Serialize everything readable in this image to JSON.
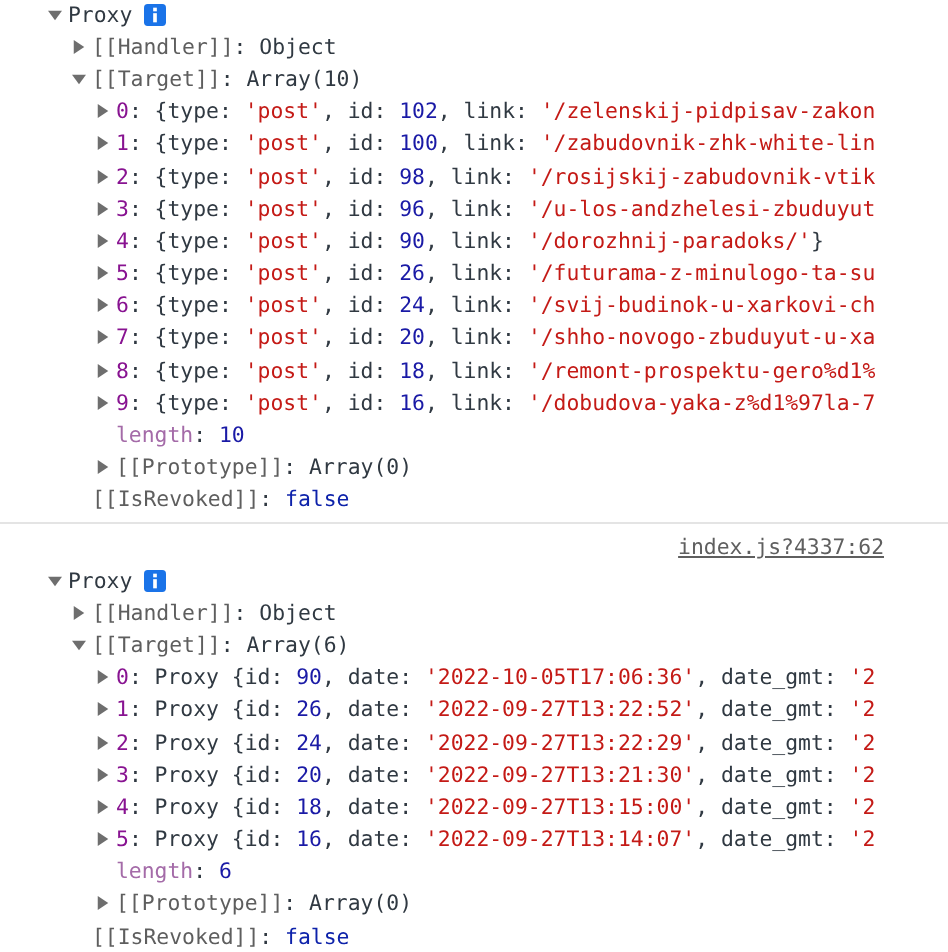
{
  "logs": [
    {
      "tree": {
        "kind": "toggle",
        "expanded": true,
        "info": true,
        "parts": [
          {
            "kind": "plain",
            "text": "Proxy"
          }
        ],
        "children": [
          {
            "kind": "toggle",
            "expanded": false,
            "parts": [
              {
                "kind": "meta",
                "text": "[[Handler]]"
              },
              {
                "kind": "plain",
                "text": ": Object"
              }
            ]
          },
          {
            "kind": "toggle",
            "expanded": true,
            "parts": [
              {
                "kind": "meta",
                "text": "[[Target]]"
              },
              {
                "kind": "plain",
                "text": ": Array(10)"
              }
            ],
            "children": [
              {
                "kind": "toggle",
                "expanded": false,
                "parts": [
                  {
                    "kind": "index",
                    "text": "0"
                  },
                  {
                    "kind": "plain",
                    "text": ": {type: "
                  },
                  {
                    "kind": "str",
                    "text": "'post'"
                  },
                  {
                    "kind": "plain",
                    "text": ", id: "
                  },
                  {
                    "kind": "num",
                    "text": "102"
                  },
                  {
                    "kind": "plain",
                    "text": ", link: "
                  },
                  {
                    "kind": "str",
                    "text": "'/zelenskij-pidpisav-zakon"
                  }
                ]
              },
              {
                "kind": "toggle",
                "expanded": false,
                "parts": [
                  {
                    "kind": "index",
                    "text": "1"
                  },
                  {
                    "kind": "plain",
                    "text": ": {type: "
                  },
                  {
                    "kind": "str",
                    "text": "'post'"
                  },
                  {
                    "kind": "plain",
                    "text": ", id: "
                  },
                  {
                    "kind": "num",
                    "text": "100"
                  },
                  {
                    "kind": "plain",
                    "text": ", link: "
                  },
                  {
                    "kind": "str",
                    "text": "'/zabudovnik-zhk-white-lin"
                  }
                ]
              },
              {
                "kind": "toggle",
                "expanded": false,
                "parts": [
                  {
                    "kind": "index",
                    "text": "2"
                  },
                  {
                    "kind": "plain",
                    "text": ": {type: "
                  },
                  {
                    "kind": "str",
                    "text": "'post'"
                  },
                  {
                    "kind": "plain",
                    "text": ", id: "
                  },
                  {
                    "kind": "num",
                    "text": "98"
                  },
                  {
                    "kind": "plain",
                    "text": ", link: "
                  },
                  {
                    "kind": "str",
                    "text": "'/rosijskij-zabudovnik-vtik"
                  }
                ]
              },
              {
                "kind": "toggle",
                "expanded": false,
                "parts": [
                  {
                    "kind": "index",
                    "text": "3"
                  },
                  {
                    "kind": "plain",
                    "text": ": {type: "
                  },
                  {
                    "kind": "str",
                    "text": "'post'"
                  },
                  {
                    "kind": "plain",
                    "text": ", id: "
                  },
                  {
                    "kind": "num",
                    "text": "96"
                  },
                  {
                    "kind": "plain",
                    "text": ", link: "
                  },
                  {
                    "kind": "str",
                    "text": "'/u-los-andzhelesi-zbuduyut"
                  }
                ]
              },
              {
                "kind": "toggle",
                "expanded": false,
                "parts": [
                  {
                    "kind": "index",
                    "text": "4"
                  },
                  {
                    "kind": "plain",
                    "text": ": {type: "
                  },
                  {
                    "kind": "str",
                    "text": "'post'"
                  },
                  {
                    "kind": "plain",
                    "text": ", id: "
                  },
                  {
                    "kind": "num",
                    "text": "90"
                  },
                  {
                    "kind": "plain",
                    "text": ", link: "
                  },
                  {
                    "kind": "str",
                    "text": "'/dorozhnij-paradoks/'"
                  },
                  {
                    "kind": "plain",
                    "text": "}"
                  }
                ]
              },
              {
                "kind": "toggle",
                "expanded": false,
                "parts": [
                  {
                    "kind": "index",
                    "text": "5"
                  },
                  {
                    "kind": "plain",
                    "text": ": {type: "
                  },
                  {
                    "kind": "str",
                    "text": "'post'"
                  },
                  {
                    "kind": "plain",
                    "text": ", id: "
                  },
                  {
                    "kind": "num",
                    "text": "26"
                  },
                  {
                    "kind": "plain",
                    "text": ", link: "
                  },
                  {
                    "kind": "str",
                    "text": "'/futurama-z-minulogo-ta-su"
                  }
                ]
              },
              {
                "kind": "toggle",
                "expanded": false,
                "parts": [
                  {
                    "kind": "index",
                    "text": "6"
                  },
                  {
                    "kind": "plain",
                    "text": ": {type: "
                  },
                  {
                    "kind": "str",
                    "text": "'post'"
                  },
                  {
                    "kind": "plain",
                    "text": ", id: "
                  },
                  {
                    "kind": "num",
                    "text": "24"
                  },
                  {
                    "kind": "plain",
                    "text": ", link: "
                  },
                  {
                    "kind": "str",
                    "text": "'/svij-budinok-u-xarkovi-ch"
                  }
                ]
              },
              {
                "kind": "toggle",
                "expanded": false,
                "parts": [
                  {
                    "kind": "index",
                    "text": "7"
                  },
                  {
                    "kind": "plain",
                    "text": ": {type: "
                  },
                  {
                    "kind": "str",
                    "text": "'post'"
                  },
                  {
                    "kind": "plain",
                    "text": ", id: "
                  },
                  {
                    "kind": "num",
                    "text": "20"
                  },
                  {
                    "kind": "plain",
                    "text": ", link: "
                  },
                  {
                    "kind": "str",
                    "text": "'/shho-novogo-zbuduyut-u-xa"
                  }
                ]
              },
              {
                "kind": "toggle",
                "expanded": false,
                "parts": [
                  {
                    "kind": "index",
                    "text": "8"
                  },
                  {
                    "kind": "plain",
                    "text": ": {type: "
                  },
                  {
                    "kind": "str",
                    "text": "'post'"
                  },
                  {
                    "kind": "plain",
                    "text": ", id: "
                  },
                  {
                    "kind": "num",
                    "text": "18"
                  },
                  {
                    "kind": "plain",
                    "text": ", link: "
                  },
                  {
                    "kind": "str",
                    "text": "'/remont-prospektu-gero%d1%"
                  }
                ]
              },
              {
                "kind": "toggle",
                "expanded": false,
                "parts": [
                  {
                    "kind": "index",
                    "text": "9"
                  },
                  {
                    "kind": "plain",
                    "text": ": {type: "
                  },
                  {
                    "kind": "str",
                    "text": "'post'"
                  },
                  {
                    "kind": "plain",
                    "text": ", id: "
                  },
                  {
                    "kind": "num",
                    "text": "16"
                  },
                  {
                    "kind": "plain",
                    "text": ", link: "
                  },
                  {
                    "kind": "str",
                    "text": "'/dobudova-yaka-z%d1%97la-7"
                  }
                ]
              },
              {
                "kind": "leaf",
                "parts": [
                  {
                    "kind": "lenkey",
                    "text": "length"
                  },
                  {
                    "kind": "plain",
                    "text": ": "
                  },
                  {
                    "kind": "num",
                    "text": "10"
                  }
                ]
              },
              {
                "kind": "toggle",
                "expanded": false,
                "parts": [
                  {
                    "kind": "meta",
                    "text": "[[Prototype]]"
                  },
                  {
                    "kind": "plain",
                    "text": ": Array(0)"
                  }
                ]
              }
            ]
          },
          {
            "kind": "leaf",
            "parts": [
              {
                "kind": "meta",
                "text": "[[IsRevoked]]"
              },
              {
                "kind": "plain",
                "text": ": "
              },
              {
                "kind": "bool",
                "text": "false"
              }
            ]
          }
        ]
      }
    },
    {
      "source": "index.js?4337:62",
      "tree": {
        "kind": "toggle",
        "expanded": true,
        "info": true,
        "parts": [
          {
            "kind": "plain",
            "text": "Proxy"
          }
        ],
        "children": [
          {
            "kind": "toggle",
            "expanded": false,
            "parts": [
              {
                "kind": "meta",
                "text": "[[Handler]]"
              },
              {
                "kind": "plain",
                "text": ": Object"
              }
            ]
          },
          {
            "kind": "toggle",
            "expanded": true,
            "parts": [
              {
                "kind": "meta",
                "text": "[[Target]]"
              },
              {
                "kind": "plain",
                "text": ": Array(6)"
              }
            ],
            "children": [
              {
                "kind": "toggle",
                "expanded": false,
                "parts": [
                  {
                    "kind": "index",
                    "text": "0"
                  },
                  {
                    "kind": "plain",
                    "text": ": Proxy {id: "
                  },
                  {
                    "kind": "num",
                    "text": "90"
                  },
                  {
                    "kind": "plain",
                    "text": ", date: "
                  },
                  {
                    "kind": "str",
                    "text": "'2022-10-05T17:06:36'"
                  },
                  {
                    "kind": "plain",
                    "text": ", date_gmt: "
                  },
                  {
                    "kind": "str",
                    "text": "'2"
                  }
                ]
              },
              {
                "kind": "toggle",
                "expanded": false,
                "parts": [
                  {
                    "kind": "index",
                    "text": "1"
                  },
                  {
                    "kind": "plain",
                    "text": ": Proxy {id: "
                  },
                  {
                    "kind": "num",
                    "text": "26"
                  },
                  {
                    "kind": "plain",
                    "text": ", date: "
                  },
                  {
                    "kind": "str",
                    "text": "'2022-09-27T13:22:52'"
                  },
                  {
                    "kind": "plain",
                    "text": ", date_gmt: "
                  },
                  {
                    "kind": "str",
                    "text": "'2"
                  }
                ]
              },
              {
                "kind": "toggle",
                "expanded": false,
                "parts": [
                  {
                    "kind": "index",
                    "text": "2"
                  },
                  {
                    "kind": "plain",
                    "text": ": Proxy {id: "
                  },
                  {
                    "kind": "num",
                    "text": "24"
                  },
                  {
                    "kind": "plain",
                    "text": ", date: "
                  },
                  {
                    "kind": "str",
                    "text": "'2022-09-27T13:22:29'"
                  },
                  {
                    "kind": "plain",
                    "text": ", date_gmt: "
                  },
                  {
                    "kind": "str",
                    "text": "'2"
                  }
                ]
              },
              {
                "kind": "toggle",
                "expanded": false,
                "parts": [
                  {
                    "kind": "index",
                    "text": "3"
                  },
                  {
                    "kind": "plain",
                    "text": ": Proxy {id: "
                  },
                  {
                    "kind": "num",
                    "text": "20"
                  },
                  {
                    "kind": "plain",
                    "text": ", date: "
                  },
                  {
                    "kind": "str",
                    "text": "'2022-09-27T13:21:30'"
                  },
                  {
                    "kind": "plain",
                    "text": ", date_gmt: "
                  },
                  {
                    "kind": "str",
                    "text": "'2"
                  }
                ]
              },
              {
                "kind": "toggle",
                "expanded": false,
                "parts": [
                  {
                    "kind": "index",
                    "text": "4"
                  },
                  {
                    "kind": "plain",
                    "text": ": Proxy {id: "
                  },
                  {
                    "kind": "num",
                    "text": "18"
                  },
                  {
                    "kind": "plain",
                    "text": ", date: "
                  },
                  {
                    "kind": "str",
                    "text": "'2022-09-27T13:15:00'"
                  },
                  {
                    "kind": "plain",
                    "text": ", date_gmt: "
                  },
                  {
                    "kind": "str",
                    "text": "'2"
                  }
                ]
              },
              {
                "kind": "toggle",
                "expanded": false,
                "parts": [
                  {
                    "kind": "index",
                    "text": "5"
                  },
                  {
                    "kind": "plain",
                    "text": ": Proxy {id: "
                  },
                  {
                    "kind": "num",
                    "text": "16"
                  },
                  {
                    "kind": "plain",
                    "text": ", date: "
                  },
                  {
                    "kind": "str",
                    "text": "'2022-09-27T13:14:07'"
                  },
                  {
                    "kind": "plain",
                    "text": ", date_gmt: "
                  },
                  {
                    "kind": "str",
                    "text": "'2"
                  }
                ]
              },
              {
                "kind": "leaf",
                "parts": [
                  {
                    "kind": "lenkey",
                    "text": "length"
                  },
                  {
                    "kind": "plain",
                    "text": ": "
                  },
                  {
                    "kind": "num",
                    "text": "6"
                  }
                ]
              },
              {
                "kind": "toggle",
                "expanded": false,
                "parts": [
                  {
                    "kind": "meta",
                    "text": "[[Prototype]]"
                  },
                  {
                    "kind": "plain",
                    "text": ": Array(0)"
                  }
                ]
              }
            ]
          },
          {
            "kind": "leaf",
            "parts": [
              {
                "kind": "meta",
                "text": "[[IsRevoked]]"
              },
              {
                "kind": "plain",
                "text": ": "
              },
              {
                "kind": "bool",
                "text": "false"
              }
            ]
          }
        ]
      }
    }
  ]
}
